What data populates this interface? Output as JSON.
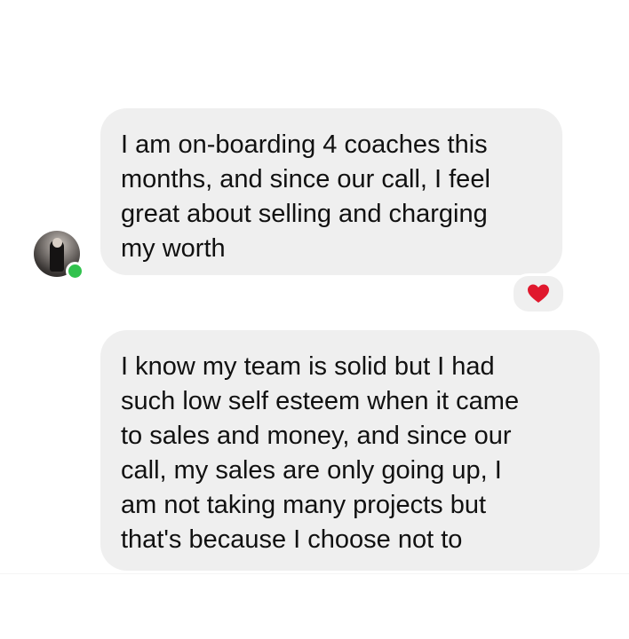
{
  "messages": [
    {
      "text": "I am on-boarding 4 coaches this\nmonths, and since our call, I feel\ngreat about selling and charging\nmy worth",
      "reaction_icon": "heart-icon"
    },
    {
      "text": "I know my team is solid but I had\nsuch low self esteem when it came\nto sales and money, and since our\ncall, my sales are only going up, I\nam not taking many projects but\nthat's because I choose not to"
    }
  ],
  "avatar": {
    "status": "online",
    "status_color": "#31c24d"
  },
  "colors": {
    "bubble_bg": "#efefef",
    "reaction_heart": "#e0182d"
  }
}
